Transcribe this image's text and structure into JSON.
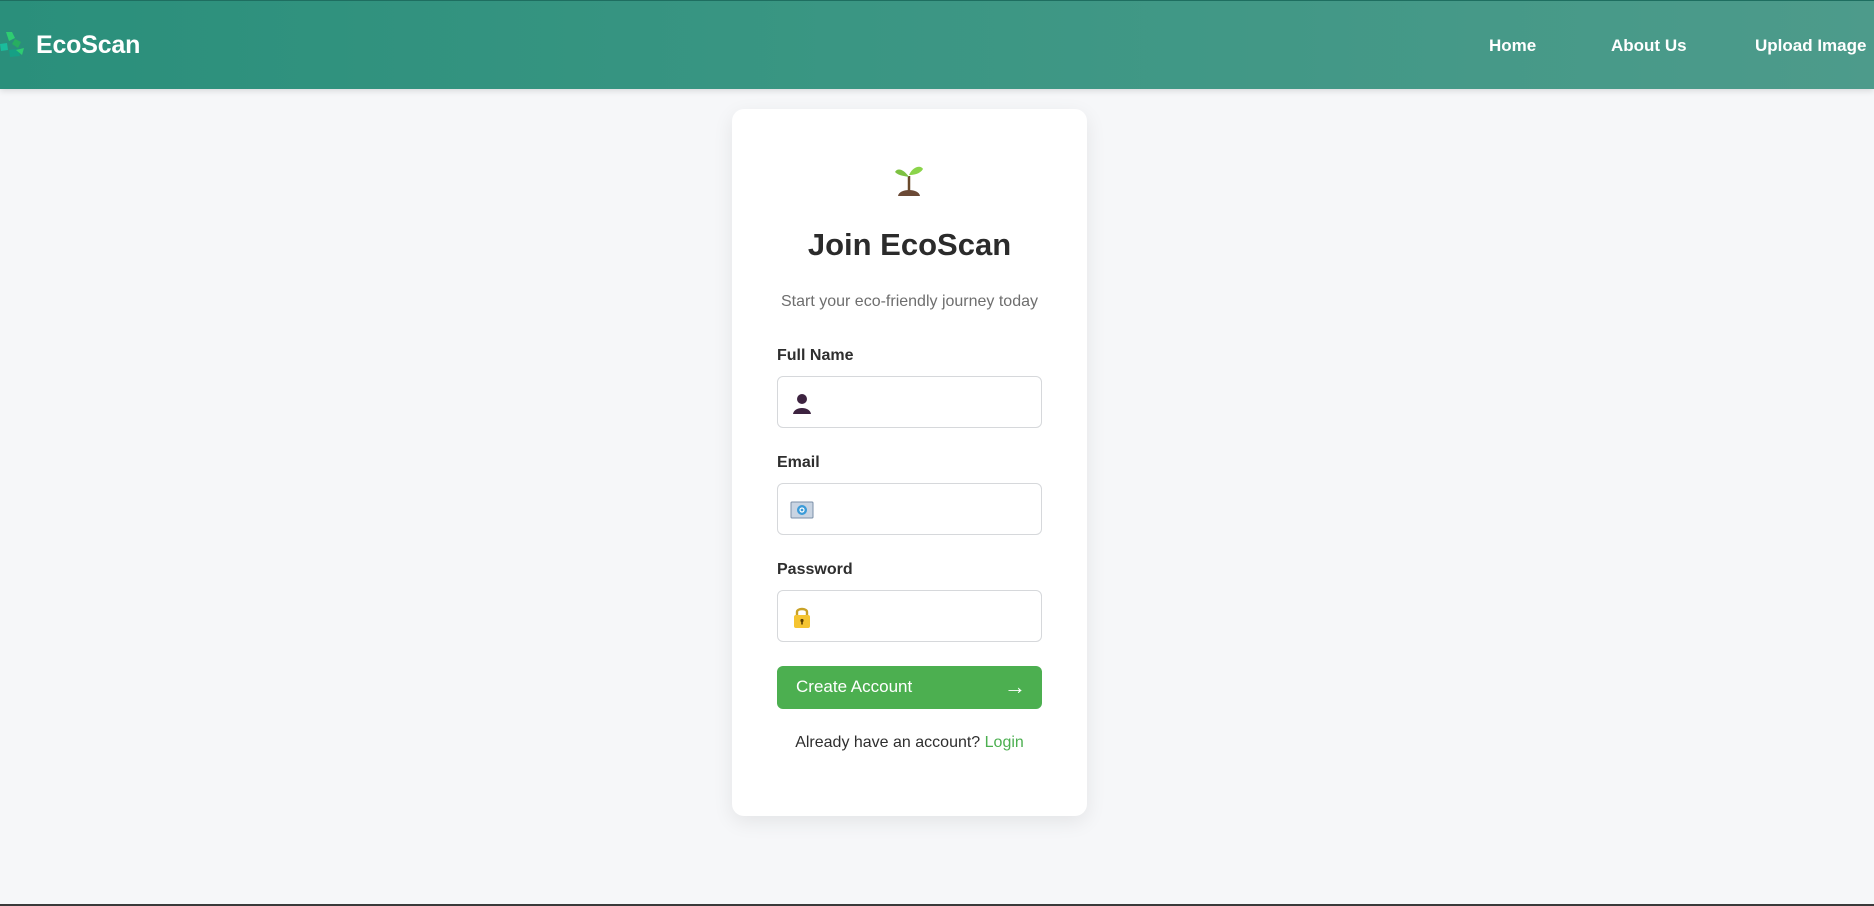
{
  "navbar": {
    "brand": "EcoScan",
    "brand_icon": "recycle-icon",
    "links": {
      "home": "Home",
      "about": "About Us",
      "upload": "Upload Image"
    }
  },
  "card": {
    "icon": "seedling-icon",
    "title": "Join EcoScan",
    "subtitle": "Start your eco-friendly journey today",
    "fields": {
      "name": {
        "label": "Full Name",
        "value": "",
        "icon": "person-icon"
      },
      "email": {
        "label": "Email",
        "value": "",
        "icon": "email-icon"
      },
      "password": {
        "label": "Password",
        "value": "",
        "icon": "lock-icon"
      }
    },
    "submit": {
      "label": "Create Account",
      "arrow": "→"
    },
    "login_prompt": "Already have an account?",
    "login_link": "Login"
  },
  "colors": {
    "header_start": "#2a8f7b",
    "header_end": "#4d9b8b",
    "accent": "#4caf50",
    "background": "#f6f7f9"
  }
}
